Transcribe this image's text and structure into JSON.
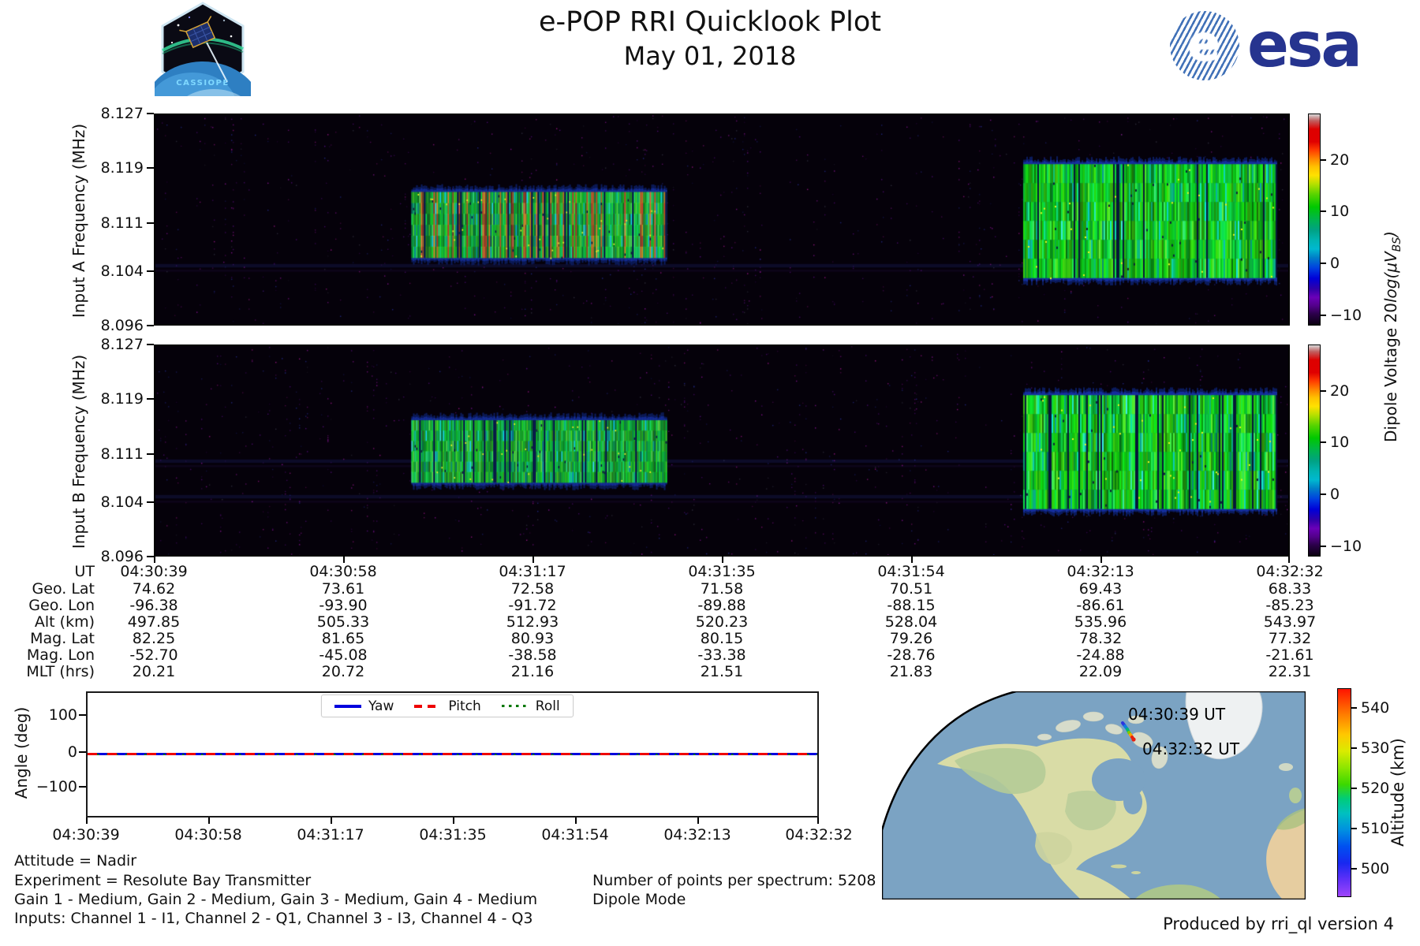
{
  "header": {
    "title": "e-POP RRI Quicklook Plot",
    "subtitle": "May 01, 2018",
    "cassiope_label": "CASSIOPE",
    "esa_label": "esa"
  },
  "spectrograms": {
    "panel_a": {
      "ylabel": "Input A Frequency (MHz)",
      "yticks": [
        "8.127",
        "8.119",
        "8.111",
        "8.104",
        "8.096"
      ]
    },
    "panel_b": {
      "ylabel": "Input B Frequency (MHz)",
      "yticks": [
        "8.127",
        "8.119",
        "8.111",
        "8.104",
        "8.096"
      ]
    },
    "colorbar": {
      "label_plain": "Dipole Voltage 20",
      "label_italic": "log(μV",
      "label_sub": "BS",
      "label_close": ")",
      "ticks": [
        "20",
        "10",
        "0",
        "−10"
      ]
    }
  },
  "ephemeris_table": {
    "row_labels": [
      "UT",
      "Geo. Lat",
      "Geo. Lon",
      "Alt (km)",
      "Mag. Lat",
      "Mag. Lon",
      "MLT (hrs)"
    ],
    "columns": [
      [
        "04:30:39",
        "74.62",
        "-96.38",
        "497.85",
        "82.25",
        "-52.70",
        "20.21"
      ],
      [
        "04:30:58",
        "73.61",
        "-93.90",
        "505.33",
        "81.65",
        "-45.08",
        "20.72"
      ],
      [
        "04:31:17",
        "72.58",
        "-91.72",
        "512.93",
        "80.93",
        "-38.58",
        "21.16"
      ],
      [
        "04:31:35",
        "71.58",
        "-89.88",
        "520.23",
        "80.15",
        "-33.38",
        "21.51"
      ],
      [
        "04:31:54",
        "70.51",
        "-88.15",
        "528.04",
        "79.26",
        "-28.76",
        "21.83"
      ],
      [
        "04:32:13",
        "69.43",
        "-86.61",
        "535.96",
        "78.32",
        "-24.88",
        "22.09"
      ],
      [
        "04:32:32",
        "68.33",
        "-85.23",
        "543.97",
        "77.32",
        "-21.61",
        "22.31"
      ]
    ]
  },
  "angle_plot": {
    "ylabel": "Angle (deg)",
    "yticks": [
      "100",
      "0",
      "−100"
    ],
    "xticks": [
      "04:30:39",
      "04:30:58",
      "04:31:17",
      "04:31:35",
      "04:31:54",
      "04:32:13",
      "04:32:32"
    ],
    "legend": [
      {
        "label": "Yaw",
        "color": "#0000dd",
        "style": "solid"
      },
      {
        "label": "Pitch",
        "color": "#ee0000",
        "style": "dashed"
      },
      {
        "label": "Roll",
        "color": "#007700",
        "style": "dotted"
      }
    ]
  },
  "info": {
    "lines_left": [
      "Attitude = Nadir",
      "Experiment = Resolute Bay Transmitter",
      "Gain 1 - Medium, Gain 2 - Medium, Gain 3 - Medium, Gain 4 - Medium",
      "Inputs: Channel 1 - I1, Channel 2 - Q1, Channel 3 - I3, Channel 4 - Q3"
    ],
    "lines_right": [
      "Number of points per spectrum: 5208",
      "Dipole Mode"
    ]
  },
  "map": {
    "start_label": "04:30:39 UT",
    "end_label": "04:32:32 UT",
    "colorbar": {
      "label": "Altitude (km)",
      "ticks": [
        "540",
        "530",
        "520",
        "510",
        "500"
      ]
    }
  },
  "footer": {
    "credit": "Produced by rri_ql version 4"
  },
  "chart_data": [
    {
      "type": "heatmap",
      "title": "Input A spectrogram",
      "xlabel": "UT",
      "ylabel": "Input A Frequency (MHz)",
      "x_range": [
        "04:30:39",
        "04:32:32"
      ],
      "ylim": [
        8.096,
        8.127
      ],
      "yticks": [
        8.127,
        8.119,
        8.111,
        8.104,
        8.096
      ],
      "colorbar": {
        "label": "Dipole Voltage 20log(uV_BS)",
        "ticks": [
          20,
          10,
          0,
          -10
        ],
        "range": [
          -12,
          29
        ]
      },
      "background_level_dB": -10,
      "bursts": [
        {
          "t_start": "04:31:05",
          "t_end": "04:31:29",
          "f_low_MHz": 8.106,
          "f_high_MHz": 8.116,
          "peak_dB": 27,
          "typical_dB": 15
        },
        {
          "t_start": "04:32:04",
          "t_end": "04:32:31",
          "f_low_MHz": 8.103,
          "f_high_MHz": 8.119,
          "peak_dB": 18,
          "typical_dB": 12
        }
      ],
      "render": {
        "seed": 11,
        "bursts": [
          {
            "x0": 0.226,
            "x1": 0.451,
            "y0": 0.368,
            "y1": 0.682,
            "hot": true
          },
          {
            "x0": 0.766,
            "x1": 0.989,
            "y0": 0.235,
            "y1": 0.778,
            "hot": false
          }
        ],
        "hbands": [
          0.72
        ]
      }
    },
    {
      "type": "heatmap",
      "title": "Input B spectrogram",
      "xlabel": "UT",
      "ylabel": "Input B Frequency (MHz)",
      "x_range": [
        "04:30:39",
        "04:32:32"
      ],
      "ylim": [
        8.096,
        8.127
      ],
      "yticks": [
        8.127,
        8.119,
        8.111,
        8.104,
        8.096
      ],
      "colorbar": {
        "label": "Dipole Voltage 20log(uV_BS)",
        "ticks": [
          20,
          10,
          0,
          -10
        ],
        "range": [
          -12,
          29
        ]
      },
      "background_level_dB": -10,
      "bursts": [
        {
          "t_start": "04:31:05",
          "t_end": "04:31:29",
          "f_low_MHz": 8.107,
          "f_high_MHz": 8.115,
          "peak_dB": 18,
          "typical_dB": 12
        },
        {
          "t_start": "04:32:04",
          "t_end": "04:32:31",
          "f_low_MHz": 8.103,
          "f_high_MHz": 8.119,
          "peak_dB": 18,
          "typical_dB": 12
        }
      ],
      "render": {
        "seed": 23,
        "bursts": [
          {
            "x0": 0.226,
            "x1": 0.451,
            "y0": 0.355,
            "y1": 0.652,
            "hot": false
          },
          {
            "x0": 0.766,
            "x1": 0.989,
            "y0": 0.235,
            "y1": 0.778,
            "hot": false
          }
        ],
        "hbands": [
          0.55,
          0.72
        ]
      }
    },
    {
      "type": "line",
      "title": "Attitude angles",
      "ylabel": "Angle (deg)",
      "ylim": [
        -175,
        165
      ],
      "yticks": [
        100,
        0,
        -100
      ],
      "x": [
        "04:30:39",
        "04:30:58",
        "04:31:17",
        "04:31:35",
        "04:31:54",
        "04:32:13",
        "04:32:32"
      ],
      "series": [
        {
          "name": "Yaw",
          "values": [
            0,
            0,
            0,
            0,
            0,
            0,
            0
          ]
        },
        {
          "name": "Pitch",
          "values": [
            0,
            0,
            0,
            0,
            0,
            0,
            0
          ]
        },
        {
          "name": "Roll",
          "values": [
            0,
            0,
            0,
            0,
            0,
            0,
            0
          ]
        }
      ],
      "legend_position": "upper center"
    },
    {
      "type": "map",
      "title": "Ground track",
      "track": {
        "start": {
          "ut": "04:30:39",
          "lat": 74.62,
          "lon": -96.38,
          "alt_km": 497.85
        },
        "end": {
          "ut": "04:32:32",
          "lat": 68.33,
          "lon": -85.23,
          "alt_km": 543.97
        }
      },
      "colorbar": {
        "label": "Altitude (km)",
        "ticks": [
          540,
          530,
          520,
          510,
          500
        ],
        "range": [
          493,
          545
        ]
      }
    }
  ]
}
